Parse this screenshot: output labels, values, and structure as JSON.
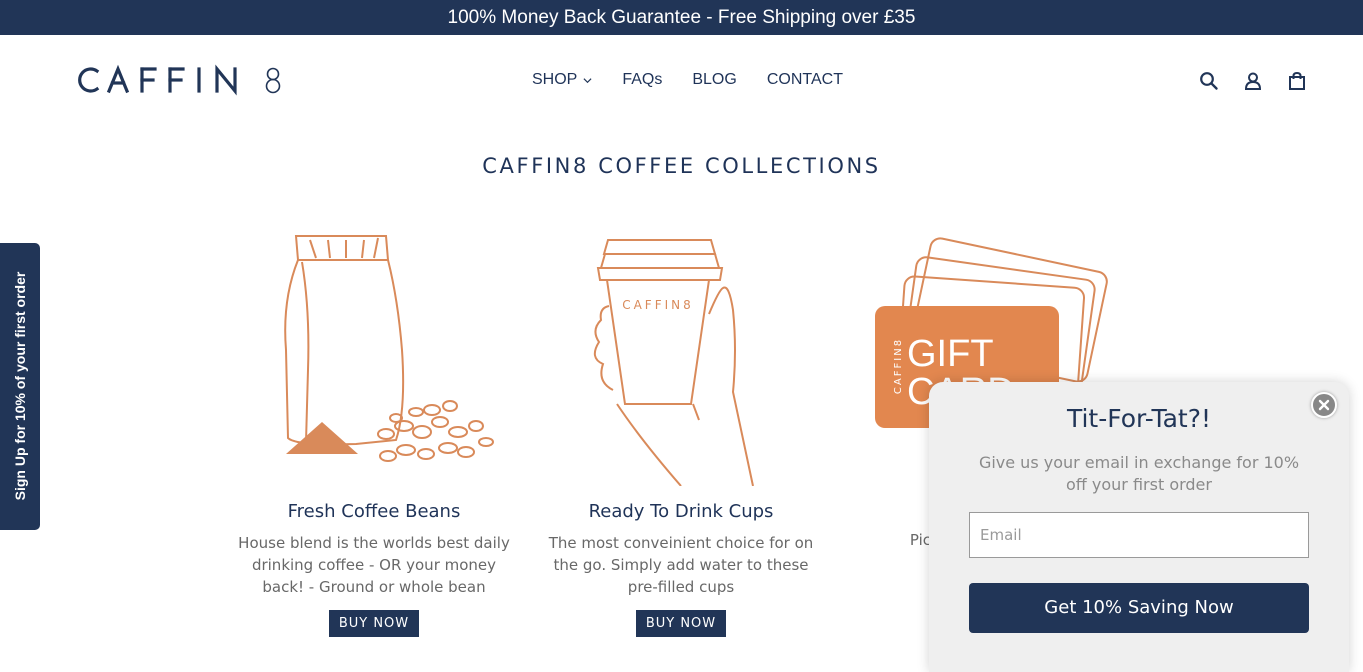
{
  "announcement": "100% Money Back Guarantee - Free Shipping over £35",
  "brand": {
    "logo_text": "CAFFIN8"
  },
  "nav": {
    "items": [
      {
        "label": "SHOP",
        "has_dropdown": true
      },
      {
        "label": "FAQs"
      },
      {
        "label": "BLOG"
      },
      {
        "label": "CONTACT"
      }
    ]
  },
  "header_icons": [
    "search-icon",
    "account-icon",
    "cart-icon"
  ],
  "page_title": "CAFFIN8 COFFEE COLLECTIONS",
  "collections": [
    {
      "title": "Fresh Coffee Beans",
      "description": "House blend is the worlds best daily drinking coffee - OR your money back! - Ground or whole bean",
      "button": "BUY NOW"
    },
    {
      "title": "Ready To Drink Cups",
      "description": "The most conveinient choice for on the go. Simply add water to these pre-filled cups",
      "button": "BUY NOW",
      "cup_brand": "CAFFIN8"
    },
    {
      "title": "",
      "description_visible": "Pick up a gi freind. B",
      "card_text": {
        "big": "GIFT CARD",
        "brand": "CAFFIN8"
      }
    }
  ],
  "side_tab": {
    "label": "Sign Up for 10% of your first order"
  },
  "popup": {
    "title": "Tit-For-Tat?!",
    "subtitle": "Give us your email in exchange for 10% off your first order",
    "email_placeholder": "Email",
    "cta": "Get 10% Saving Now"
  },
  "colors": {
    "navy": "#213557",
    "copper": "#d98a5a",
    "text_gray": "#686868"
  }
}
